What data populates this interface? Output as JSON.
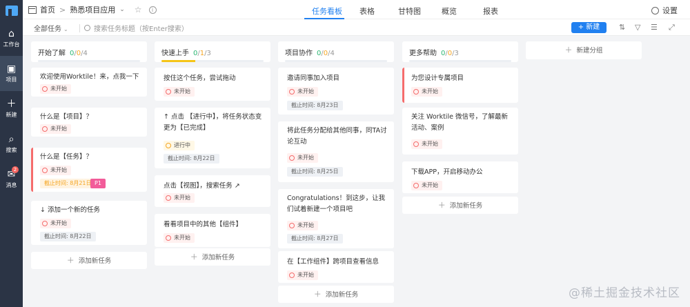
{
  "sidebar": {
    "items": [
      {
        "label": "工作台",
        "icon": "home-icon"
      },
      {
        "label": "项目",
        "icon": "project-icon"
      },
      {
        "label": "新建",
        "icon": "plus-icon"
      },
      {
        "label": "搜索",
        "icon": "search-icon"
      },
      {
        "label": "消息",
        "icon": "message-icon",
        "badge": "2"
      }
    ]
  },
  "header": {
    "breadcrumb_home": "首页",
    "breadcrumb_sep": ">",
    "project_name": "熟悉项目应用",
    "tabs": [
      "任务看板",
      "表格",
      "甘特图",
      "概览",
      "报表"
    ],
    "settings_label": "设置"
  },
  "toolbar": {
    "filter_label": "全部任务",
    "search_placeholder": "搜索任务标题（按Enter搜索）",
    "new_label": "+ 新建"
  },
  "board": {
    "columns": [
      {
        "title": "开始了解",
        "done": "0",
        "doing": "0",
        "total": "4",
        "progress": 0,
        "cards": [
          {
            "title": "欢迎使用Worktile！来，点我一下~",
            "status": "未开始"
          },
          {
            "title": "什么是【项目】？",
            "status": "未开始"
          },
          {
            "title": "什么是【任务】？",
            "status": "未开始",
            "due": "截止时间: 8月21日",
            "priority": "P1"
          },
          {
            "title": "↓ 添加一个新的任务",
            "status": "未开始",
            "due": "截止时间: 8月22日"
          }
        ],
        "add_label": "添加新任务"
      },
      {
        "title": "快速上手",
        "done": "0",
        "doing": "1",
        "total": "3",
        "progress": 0.33,
        "cards": [
          {
            "title": "按住这个任务，尝试拖动",
            "status": "未开始"
          },
          {
            "title": "↑ 点击 【进行中】，将任务状态变更为【已完成】",
            "status": "进行中",
            "due": "截止时间: 8月22日"
          },
          {
            "title": "点击【视图】，搜索任务 ↗",
            "status": "未开始"
          },
          {
            "title": "看看项目中的其他【组件】",
            "status": "未开始"
          }
        ],
        "add_label": "添加新任务"
      },
      {
        "title": "项目协作",
        "done": "0",
        "doing": "0",
        "total": "4",
        "progress": 0,
        "cards": [
          {
            "title": "邀请同事加入项目",
            "status": "未开始",
            "due": "截止时间: 8月23日"
          },
          {
            "title": "将此任务分配给其他同事，同TA讨论互动",
            "status": "未开始",
            "due": "截止时间: 8月25日"
          },
          {
            "title": "Congratulations！到这步，让我们试着新建一个项目吧",
            "status": "未开始",
            "due": "截止时间: 8月27日"
          },
          {
            "title": "在【工作组件】跨项目查看信息",
            "status": "未开始"
          }
        ],
        "add_label": "添加新任务"
      },
      {
        "title": "更多帮助",
        "done": "0",
        "doing": "0",
        "total": "3",
        "progress": 0,
        "cards": [
          {
            "title": "为您设计专属项目",
            "status": "未开始"
          },
          {
            "title": "关注 Worktile 微信号，了解最新活动、案例",
            "status": "未开始"
          },
          {
            "title": "下载APP，开启移动办公",
            "status": "未开始"
          }
        ],
        "add_label": "添加新任务"
      }
    ],
    "add_group_label": "新建分组"
  },
  "watermark": "@稀土掘金技术社区",
  "colors": {
    "accent": "#2080f0",
    "sidebar": "#2b3445",
    "urgent": "#f56c6c",
    "progress": "#f5c518",
    "priority": "#f25c9a"
  }
}
